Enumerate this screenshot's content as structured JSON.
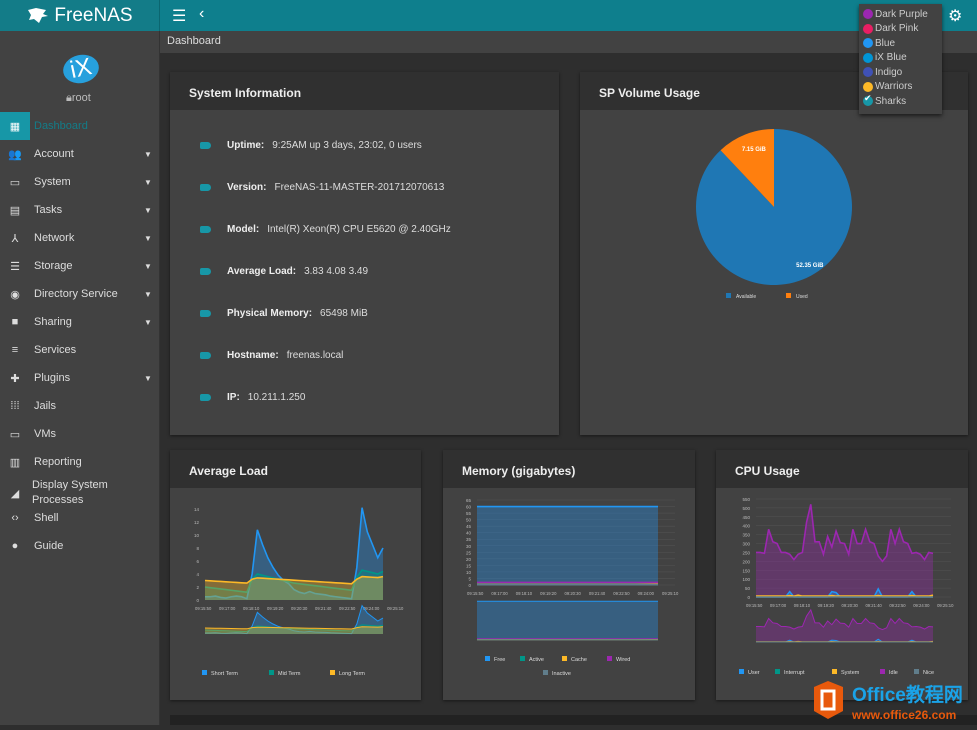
{
  "app": {
    "brand": "FreeNAS",
    "breadcrumb": "Dashboard"
  },
  "header": {
    "menu_icon": "hamburger-icon",
    "back_icon": "chevron-left-icon",
    "settings_icon": "gear-icon"
  },
  "user": {
    "avatar_text": "iX",
    "name": "root"
  },
  "sidebar": {
    "items": [
      {
        "label": "Dashboard",
        "icon": "dashboard-icon",
        "glyph": "▦",
        "expandable": false,
        "active": true
      },
      {
        "label": "Account",
        "icon": "people-icon",
        "glyph": "👥",
        "expandable": true
      },
      {
        "label": "System",
        "icon": "laptop-icon",
        "glyph": "▭",
        "expandable": true
      },
      {
        "label": "Tasks",
        "icon": "calendar-icon",
        "glyph": "▤",
        "expandable": true
      },
      {
        "label": "Network",
        "icon": "network-icon",
        "glyph": "⅄",
        "expandable": true
      },
      {
        "label": "Storage",
        "icon": "storage-list-icon",
        "glyph": "☰",
        "expandable": true
      },
      {
        "label": "Directory Service",
        "icon": "directory-service-icon",
        "glyph": "◉",
        "expandable": true
      },
      {
        "label": "Sharing",
        "icon": "shared-folder-icon",
        "glyph": "■",
        "expandable": true
      },
      {
        "label": "Services",
        "icon": "tune-icon",
        "glyph": "≡",
        "expandable": false
      },
      {
        "label": "Plugins",
        "icon": "puzzle-icon",
        "glyph": "✚",
        "expandable": true
      },
      {
        "label": "Jails",
        "icon": "grid-icon",
        "glyph": "⁞⁞⁞",
        "expandable": false
      },
      {
        "label": "VMs",
        "icon": "laptop-icon",
        "glyph": "▭",
        "expandable": false
      },
      {
        "label": "Reporting",
        "icon": "chart-icon",
        "glyph": "▥",
        "expandable": false
      },
      {
        "label": "Display System Processes",
        "icon": "processes-icon",
        "glyph": "◢",
        "expandable": false
      },
      {
        "label": "Shell",
        "icon": "code-icon",
        "glyph": "‹›",
        "expandable": false
      },
      {
        "label": "Guide",
        "icon": "info-icon",
        "glyph": "●",
        "expandable": false
      }
    ]
  },
  "theme_menu": {
    "items": [
      {
        "label": "Dark Purple",
        "color": "#9c27b0"
      },
      {
        "label": "Dark Pink",
        "color": "#e91e63"
      },
      {
        "label": "Blue",
        "color": "#2196f3"
      },
      {
        "label": "iX Blue",
        "color": "#0095d5"
      },
      {
        "label": "Indigo",
        "color": "#3f51b5"
      },
      {
        "label": "Warriors",
        "color": "#fdb927"
      },
      {
        "label": "Sharks",
        "color": "#1797a7",
        "selected": true
      }
    ]
  },
  "system_info": {
    "title": "System Information",
    "rows": [
      {
        "label": "Uptime:",
        "value": "9:25AM up 3 days, 23:02, 0 users"
      },
      {
        "label": "Version:",
        "value": "FreeNAS-11-MASTER-201712070613"
      },
      {
        "label": "Model:",
        "value": "Intel(R) Xeon(R) CPU E5620 @ 2.40GHz"
      },
      {
        "label": "Average Load:",
        "value": "3.83 4.08 3.49"
      },
      {
        "label": "Physical Memory:",
        "value": "65498 MiB"
      },
      {
        "label": "Hostname:",
        "value": "freenas.local"
      },
      {
        "label": "IP:",
        "value": "10.211.1.250"
      }
    ]
  },
  "colors": {
    "accent": "#1797a7",
    "topbar": "#0e7f8d"
  },
  "chart_data": [
    {
      "type": "pie",
      "title": "SP Volume Usage",
      "categories": [
        "Available",
        "Used"
      ],
      "values": [
        52.35,
        7.15
      ],
      "labels": [
        "52.35 GiB",
        "7.15 GiB"
      ],
      "colors": [
        "#1f77b4",
        "#ff7f0e"
      ],
      "legend": "bottom"
    },
    {
      "type": "area",
      "title": "Average Load",
      "x": [
        "09:15:50",
        "09:17:00",
        "09:18:10",
        "09:19:20",
        "09:20:30",
        "09:21:40",
        "09:22:50",
        "09:24:00",
        "09:25:10"
      ],
      "ylim": [
        0,
        14
      ],
      "yticks": [
        0,
        2,
        4,
        6,
        8,
        10,
        12,
        14
      ],
      "series": [
        {
          "name": "Short Term",
          "color": "#2196f3",
          "values": [
            0.5,
            0.5,
            0.6,
            0.4,
            0.3,
            0.5,
            0.6,
            0.5,
            0.2,
            4,
            10.8,
            8.5,
            6.5,
            5,
            3.8,
            3,
            2.5,
            1.6,
            1.2,
            1.0,
            1.3,
            1.0,
            0.9,
            0.8,
            0.6,
            0.5,
            0.4,
            0.3,
            0.2,
            5,
            14.2,
            10.5,
            8.5,
            6.5,
            8
          ]
        },
        {
          "name": "Mid Term",
          "color": "#009688",
          "values": [
            2,
            1.9,
            1.8,
            1.7,
            1.6,
            1.5,
            1.4,
            1.3,
            1.2,
            3.2,
            4.0,
            3.8,
            3.6,
            3.4,
            3.2,
            3.0,
            2.8,
            2.6,
            2.5,
            2.4,
            2.3,
            2.2,
            2.1,
            2.0,
            1.9,
            1.8,
            1.7,
            1.6,
            1.5,
            3.5,
            4.6,
            4.4,
            4.2,
            4.0,
            4.4
          ]
        },
        {
          "name": "Long Term",
          "color": "#fdb927",
          "values": [
            3.0,
            2.95,
            2.9,
            2.85,
            2.8,
            2.75,
            2.7,
            2.65,
            2.6,
            3.2,
            3.4,
            3.35,
            3.3,
            3.25,
            3.2,
            3.15,
            3.1,
            3.05,
            3.0,
            2.95,
            2.9,
            2.85,
            2.8,
            2.75,
            2.7,
            2.65,
            2.6,
            2.55,
            2.5,
            3.2,
            3.6,
            3.55,
            3.5,
            3.45,
            3.6
          ]
        }
      ],
      "legend": "bottom"
    },
    {
      "type": "area",
      "title": "Memory (gigabytes)",
      "x": [
        "09:15:50",
        "09:17:00",
        "09:18:10",
        "09:19:20",
        "09:20:30",
        "09:21:40",
        "09:22:50",
        "09:24:00",
        "09:25:10"
      ],
      "ylim": [
        0,
        65
      ],
      "yticks": [
        0,
        5,
        10,
        15,
        20,
        25,
        30,
        35,
        40,
        45,
        50,
        55,
        60,
        65
      ],
      "series": [
        {
          "name": "Free",
          "color": "#2196f3",
          "values": [
            60,
            60,
            60,
            60,
            60,
            60,
            60,
            60,
            60
          ]
        },
        {
          "name": "Active",
          "color": "#009688",
          "values": [
            0.5,
            0.5,
            0.5,
            0.5,
            0.5,
            0.5,
            0.5,
            0.5,
            0.5
          ]
        },
        {
          "name": "Cache",
          "color": "#fdb927",
          "values": [
            0.3,
            0.3,
            0.3,
            0.3,
            0.3,
            0.3,
            0.3,
            0.3,
            0.5
          ]
        },
        {
          "name": "Wired",
          "color": "#9c27b0",
          "values": [
            2,
            2,
            2,
            2,
            2,
            2,
            2,
            2,
            2
          ]
        },
        {
          "name": "Inactive",
          "color": "#607d8b",
          "values": [
            0.2,
            0.2,
            0.2,
            0.2,
            0.2,
            0.2,
            0.2,
            0.2,
            0.2
          ]
        }
      ],
      "legend": "bottom"
    },
    {
      "type": "area",
      "title": "CPU Usage",
      "x": [
        "09:15:50",
        "09:17:00",
        "09:18:10",
        "09:19:20",
        "09:20:30",
        "09:21:40",
        "09:22:50",
        "09:24:00",
        "09:25:10"
      ],
      "ylim": [
        0,
        550
      ],
      "yticks": [
        0,
        50,
        100,
        150,
        200,
        250,
        300,
        350,
        400,
        450,
        500,
        550
      ],
      "series": [
        {
          "name": "User",
          "color": "#2196f3",
          "values": [
            0,
            0,
            0,
            0,
            0,
            0,
            0,
            0,
            30,
            0,
            0,
            0,
            0,
            0,
            0,
            0,
            0,
            0,
            30,
            25,
            0,
            0,
            0,
            0,
            0,
            0,
            0,
            0,
            0,
            45,
            0,
            0,
            0,
            0,
            0,
            0,
            0,
            30,
            0,
            0,
            0,
            0,
            0
          ]
        },
        {
          "name": "Interrupt",
          "color": "#009688",
          "values": [
            2,
            2,
            2,
            2,
            2,
            2,
            2,
            2,
            2,
            2,
            2,
            2,
            2,
            2,
            2,
            2,
            2,
            2,
            2,
            2,
            2,
            2,
            2,
            2,
            2,
            2,
            2,
            2,
            2,
            2,
            2,
            2,
            2,
            2,
            2,
            2,
            2,
            2,
            2,
            2,
            2,
            2,
            2
          ]
        },
        {
          "name": "System",
          "color": "#fdb927",
          "values": [
            5,
            5,
            5,
            5,
            5,
            5,
            5,
            5,
            8,
            5,
            10,
            5,
            5,
            5,
            5,
            5,
            5,
            5,
            8,
            5,
            5,
            5,
            5,
            5,
            5,
            5,
            5,
            5,
            5,
            8,
            5,
            5,
            5,
            5,
            5,
            5,
            5,
            8,
            5,
            5,
            5,
            5,
            10
          ]
        },
        {
          "name": "Idle",
          "color": "#9c27b0",
          "values": [
            250,
            250,
            245,
            380,
            310,
            300,
            250,
            250,
            240,
            210,
            240,
            250,
            420,
            520,
            310,
            310,
            240,
            340,
            280,
            370,
            305,
            300,
            240,
            380,
            300,
            300,
            380,
            310,
            300,
            230,
            200,
            230,
            380,
            300,
            380,
            310,
            300,
            245,
            250,
            240,
            210,
            250,
            245
          ]
        },
        {
          "name": "Nice",
          "color": "#607d8b",
          "values": [
            0,
            0,
            0,
            0,
            0,
            0,
            0,
            0,
            0,
            0,
            0,
            0,
            0,
            0,
            0,
            0,
            0,
            0,
            0,
            0,
            0,
            0,
            0,
            0,
            0,
            0,
            0,
            0,
            0,
            0,
            0,
            0,
            0,
            0,
            0,
            0,
            0,
            0,
            0,
            0,
            0,
            0,
            0
          ]
        }
      ],
      "legend": "bottom"
    }
  ],
  "watermark": {
    "title": "Office教程网",
    "url": "www.office26.com"
  }
}
